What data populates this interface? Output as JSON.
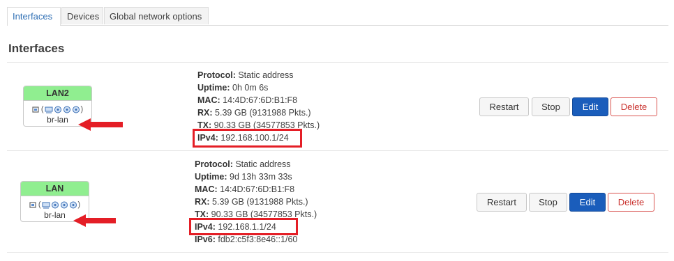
{
  "tabs": [
    {
      "label": "Interfaces",
      "active": true
    },
    {
      "label": "Devices"
    },
    {
      "label": "Global network options"
    }
  ],
  "section_title": "Interfaces",
  "interfaces": [
    {
      "name": "LAN2",
      "device": "br-lan",
      "protocol_label": "Protocol:",
      "protocol": "Static address",
      "uptime_label": "Uptime:",
      "uptime": "0h 0m 6s",
      "mac_label": "MAC:",
      "mac": "14:4D:67:6D:B1:F8",
      "rx_label": "RX:",
      "rx": "5.39 GB (9131988 Pkts.)",
      "tx_label": "TX:",
      "tx": "90.33 GB (34577853 Pkts.)",
      "ipv4_label": "IPv4:",
      "ipv4": "192.168.100.1/24"
    },
    {
      "name": "LAN",
      "device": "br-lan",
      "protocol_label": "Protocol:",
      "protocol": "Static address",
      "uptime_label": "Uptime:",
      "uptime": "9d 13h 33m 33s",
      "mac_label": "MAC:",
      "mac": "14:4D:67:6D:B1:F8",
      "rx_label": "RX:",
      "rx": "5.39 GB (9131988 Pkts.)",
      "tx_label": "TX:",
      "tx": "90.33 GB (34577853 Pkts.)",
      "ipv4_label": "IPv4:",
      "ipv4": "192.168.1.1/24",
      "ipv6_label": "IPv6:",
      "ipv6": "fdb2:c5f3:8e46::1/60"
    }
  ],
  "buttons": {
    "restart": "Restart",
    "stop": "Stop",
    "edit": "Edit",
    "delete": "Delete"
  },
  "colors": {
    "badge_header": "#90ee90",
    "edit": "#1a5dbb",
    "delete": "#d9534f",
    "highlight": "#e41e26",
    "tab_active_text": "#2f6fb4"
  },
  "icons": [
    "ethernet-icon",
    "bridge-port-icon",
    "network-port-icon"
  ]
}
